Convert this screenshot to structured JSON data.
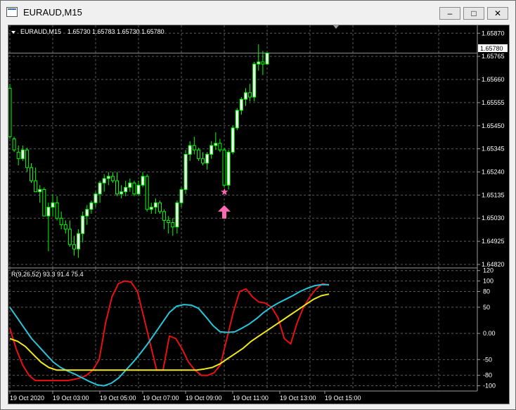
{
  "window": {
    "title": "EURAUD,M15",
    "minimize_label": "‒",
    "maximize_label": "□",
    "close_label": "✕",
    "icon": "chart-window-icon"
  },
  "main_header": {
    "symbol": "EURAUD,M15",
    "ohlc": "1.65730 1.65783 1.65730 1.65780"
  },
  "price_axis": {
    "ticks": [
      "1.65870",
      "1.65765",
      "1.65660",
      "1.65555",
      "1.65450",
      "1.65345",
      "1.65240",
      "1.65135",
      "1.65030",
      "1.64925",
      "1.64820"
    ],
    "current_price": "1.65780"
  },
  "indicator": {
    "label": "R(9,26,52) 93.3 91.4 75.4",
    "ticks": [
      "120",
      "100",
      "80",
      "50",
      "0.00",
      "-50",
      "-80",
      "-100"
    ]
  },
  "time_axis": [
    "19 Oct 2020",
    "19 Oct 03:00",
    "19 Oct 05:00",
    "19 Oct 07:00",
    "19 Oct 09:00",
    "19 Oct 11:00",
    "19 Oct 13:00",
    "19 Oct 15:00"
  ],
  "colors": {
    "background": "#000000",
    "bull_candle": "#ffffff",
    "bear_candle": "#000000",
    "candle_outline": "#00ff00",
    "grid": "#5a5a5a",
    "line_red": "#e81010",
    "line_cyan": "#26c6da",
    "line_yellow": "#f0e81a",
    "signal_pink": "#ff69b4"
  },
  "chart_data": {
    "type": "candlestick",
    "main": {
      "ylim": [
        1.64804,
        1.65906
      ],
      "candles": [
        [
          1.6562,
          1.6564,
          1.6539,
          1.654
        ],
        [
          1.6539,
          1.654,
          1.6533,
          1.6534
        ],
        [
          1.6533,
          1.6536,
          1.6527,
          1.653
        ],
        [
          1.653,
          1.6536,
          1.6529,
          1.6534
        ],
        [
          1.6534,
          1.6535,
          1.6524,
          1.6526
        ],
        [
          1.6526,
          1.6528,
          1.6519,
          1.652
        ],
        [
          1.652,
          1.6526,
          1.6515,
          1.6515
        ],
        [
          1.6515,
          1.6518,
          1.651,
          1.6516
        ],
        [
          1.6516,
          1.6517,
          1.6504,
          1.6504
        ],
        [
          1.6504,
          1.651,
          1.6488,
          1.6508
        ],
        [
          1.6508,
          1.6514,
          1.6504,
          1.651
        ],
        [
          1.651,
          1.6513,
          1.6502,
          1.6503
        ],
        [
          1.6503,
          1.6506,
          1.6498,
          1.65
        ],
        [
          1.65,
          1.6502,
          1.6496,
          1.6498
        ],
        [
          1.6498,
          1.6502,
          1.649,
          1.6491
        ],
        [
          1.6491,
          1.6495,
          1.6486,
          1.6489
        ],
        [
          1.6489,
          1.6498,
          1.6485,
          1.6496
        ],
        [
          1.6496,
          1.6506,
          1.6492,
          1.6504
        ],
        [
          1.6504,
          1.6509,
          1.65,
          1.6507
        ],
        [
          1.6507,
          1.6511,
          1.6505,
          1.651
        ],
        [
          1.651,
          1.6515,
          1.6508,
          1.6514
        ],
        [
          1.6514,
          1.652,
          1.651,
          1.6519
        ],
        [
          1.6519,
          1.6523,
          1.6515,
          1.6521
        ],
        [
          1.6521,
          1.6524,
          1.6518,
          1.6522
        ],
        [
          1.6522,
          1.6524,
          1.6519,
          1.652
        ],
        [
          1.652,
          1.6524,
          1.6513,
          1.6514
        ],
        [
          1.6514,
          1.6518,
          1.6512,
          1.6515
        ],
        [
          1.6515,
          1.652,
          1.6513,
          1.6517
        ],
        [
          1.6517,
          1.6521,
          1.6515,
          1.6519
        ],
        [
          1.6519,
          1.652,
          1.6513,
          1.6514
        ],
        [
          1.6514,
          1.652,
          1.6513,
          1.6518
        ],
        [
          1.6518,
          1.6524,
          1.6517,
          1.6522
        ],
        [
          1.6522,
          1.6523,
          1.6506,
          1.6507
        ],
        [
          1.6507,
          1.651,
          1.6505,
          1.6508
        ],
        [
          1.6508,
          1.6512,
          1.6505,
          1.651
        ],
        [
          1.651,
          1.6511,
          1.6505,
          1.6506
        ],
        [
          1.6506,
          1.6507,
          1.6498,
          1.6502
        ],
        [
          1.6502,
          1.6504,
          1.6496,
          1.6501
        ],
        [
          1.6501,
          1.6503,
          1.6495,
          1.6499
        ],
        [
          1.6499,
          1.6511,
          1.6496,
          1.651
        ],
        [
          1.651,
          1.6517,
          1.6508,
          1.6516
        ],
        [
          1.6516,
          1.6534,
          1.6514,
          1.6532
        ],
        [
          1.6532,
          1.6538,
          1.6529,
          1.6536
        ],
        [
          1.6536,
          1.654,
          1.6532,
          1.6534
        ],
        [
          1.6534,
          1.6535,
          1.6529,
          1.653
        ],
        [
          1.653,
          1.6533,
          1.6527,
          1.6528
        ],
        [
          1.6528,
          1.6533,
          1.6525,
          1.6532
        ],
        [
          1.6532,
          1.6538,
          1.653,
          1.6536
        ],
        [
          1.6536,
          1.6542,
          1.6534,
          1.6537
        ],
        [
          1.6537,
          1.6539,
          1.6533,
          1.6534
        ],
        [
          1.6534,
          1.6535,
          1.6517,
          1.6518
        ],
        [
          1.6518,
          1.6534,
          1.6516,
          1.6533
        ],
        [
          1.6533,
          1.6545,
          1.6532,
          1.6544
        ],
        [
          1.6544,
          1.6553,
          1.6543,
          1.6552
        ],
        [
          1.6552,
          1.6558,
          1.655,
          1.6557
        ],
        [
          1.6557,
          1.6562,
          1.6554,
          1.656
        ],
        [
          1.656,
          1.6564,
          1.6556,
          1.6558
        ],
        [
          1.6558,
          1.6574,
          1.6556,
          1.6573
        ],
        [
          1.6573,
          1.6582,
          1.657,
          1.6574
        ],
        [
          1.6574,
          1.6579,
          1.6568,
          1.6573
        ],
        [
          1.6573,
          1.65783,
          1.6573,
          1.6578
        ]
      ],
      "signal": {
        "candle_index": 50,
        "star_price": 1.6515,
        "arrow_price": 1.6506
      }
    },
    "oscillator": {
      "ylim": [
        -110,
        125
      ],
      "series": [
        {
          "values": [
            10,
            -30,
            -60,
            -80,
            -90,
            -90,
            -90,
            -90,
            -90,
            -90,
            -88,
            -85,
            -80,
            -70,
            -50,
            20,
            70,
            95,
            100,
            98,
            80,
            30,
            -20,
            -70,
            -70,
            -5,
            -10,
            -30,
            -55,
            -70,
            -80,
            -80,
            -75,
            -60,
            -10,
            40,
            80,
            85,
            70,
            60,
            58,
            50,
            30,
            -10,
            -20,
            20,
            50,
            70,
            85,
            95,
            92
          ]
        },
        {
          "values": [
            50,
            30,
            10,
            -10,
            -25,
            -40,
            -55,
            -65,
            -72,
            -78,
            -85,
            -92,
            -98,
            -100,
            -95,
            -85,
            -70,
            -55,
            -38,
            -20,
            0,
            20,
            40,
            52,
            55,
            54,
            48,
            32,
            15,
            3,
            2,
            3,
            10,
            18,
            28,
            40,
            50,
            58,
            65,
            72,
            80,
            86,
            91,
            93,
            93
          ]
        },
        {
          "values": [
            -10,
            -15,
            -25,
            -40,
            -55,
            -65,
            -70,
            -70,
            -70,
            -70,
            -70,
            -70,
            -70,
            -70,
            -70,
            -70,
            -70,
            -70,
            -70,
            -70,
            -70,
            -70,
            -70,
            -70,
            -70,
            -68,
            -65,
            -58,
            -48,
            -38,
            -28,
            -15,
            -5,
            5,
            15,
            25,
            35,
            45,
            55,
            65,
            72,
            75
          ]
        }
      ],
      "current_values": [
        93.3,
        91.4,
        75.4
      ]
    }
  }
}
